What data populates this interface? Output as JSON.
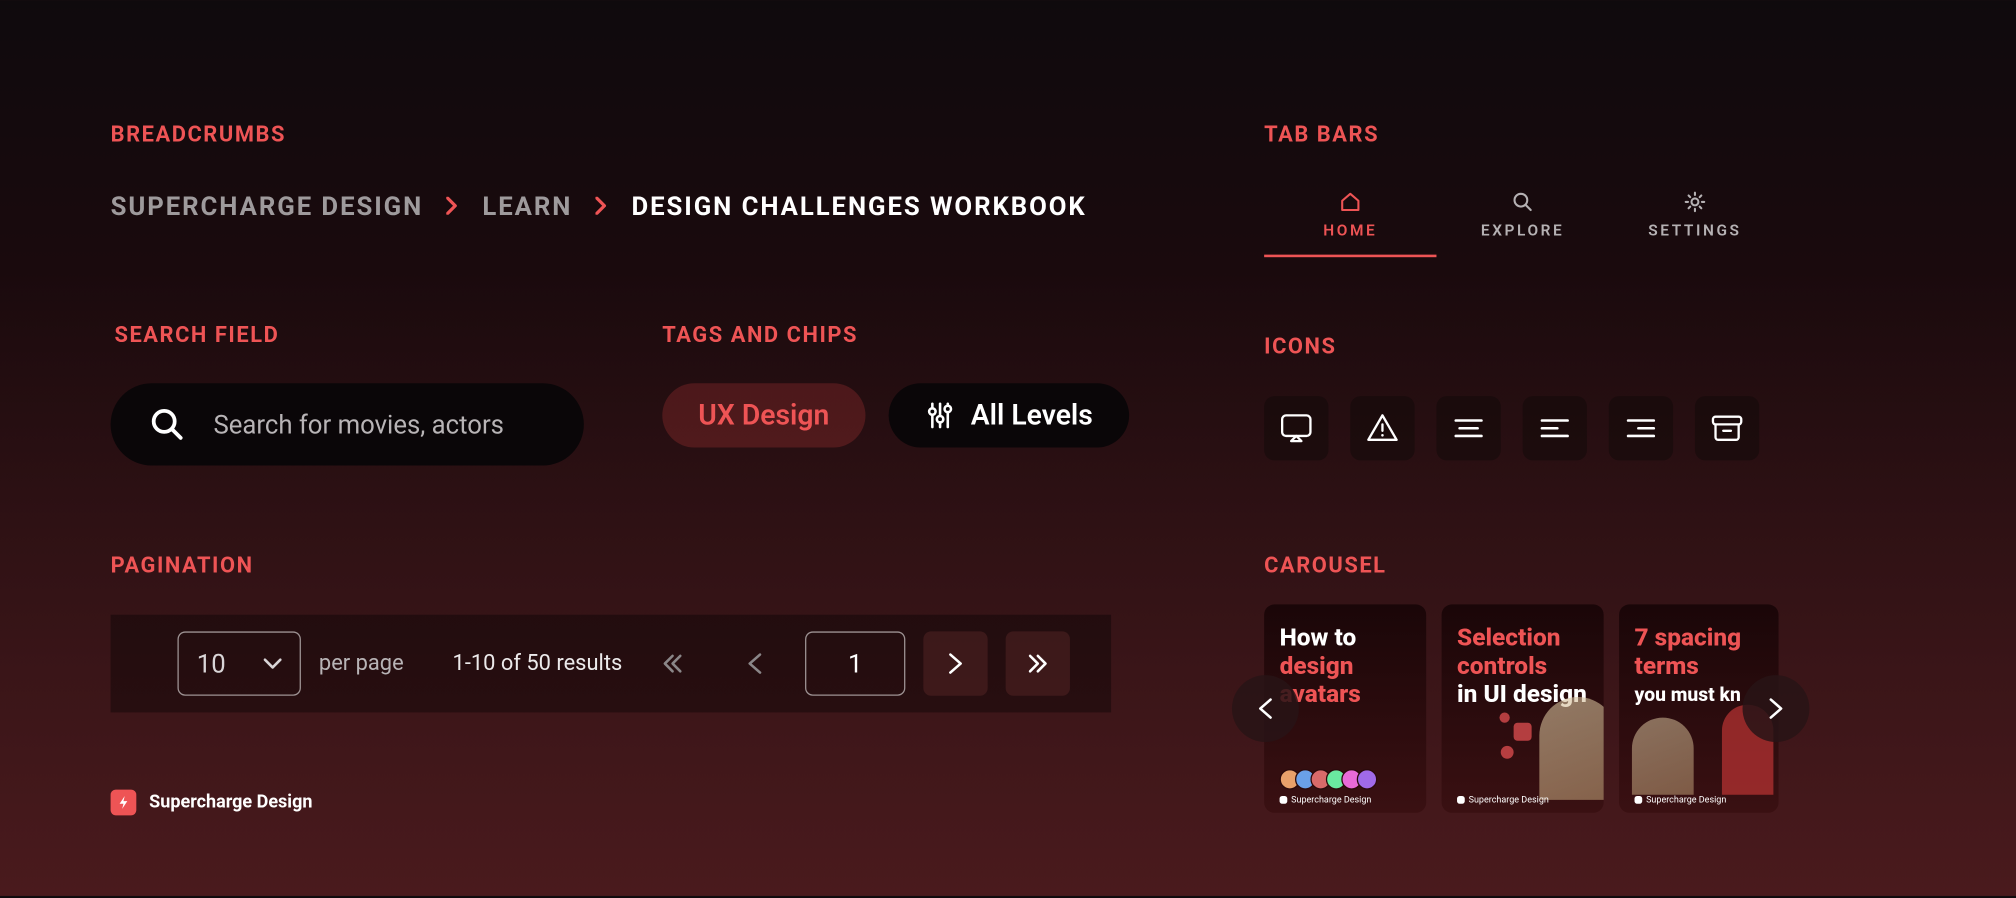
{
  "sections": {
    "breadcrumbs": "Breadcrumbs",
    "search": "Search Field",
    "tags": "Tags and Chips",
    "pagination": "Pagination",
    "tabbars": "Tab Bars",
    "icons": "Icons",
    "carousel": "Carousel"
  },
  "breadcrumbs": {
    "items": [
      {
        "label": "Supercharge Design"
      },
      {
        "label": "Learn"
      },
      {
        "label": "Design Challenges Workbook"
      }
    ]
  },
  "search": {
    "placeholder": "Search for movies, actors"
  },
  "chips": {
    "active_label": "UX Design",
    "default_label": "All Levels"
  },
  "pagination": {
    "per_page_value": "10",
    "per_page_label": "per page",
    "results_text": "1-10 of 50 results",
    "current_page": "1"
  },
  "brand": {
    "text": "Supercharge Design"
  },
  "tabs": {
    "home": "HOME",
    "explore": "EXPLORE",
    "settings": "SETTINGS"
  },
  "carousel": {
    "cards": [
      {
        "line1": "How to",
        "accent": "design",
        "line2": "avatars"
      },
      {
        "accent1": "Selection",
        "accent2": "controls",
        "line2": "in UI design"
      },
      {
        "accent1": "7 spacing",
        "accent2": "terms",
        "line2": "you must kn"
      }
    ],
    "sub_brand": "Supercharge Design"
  }
}
